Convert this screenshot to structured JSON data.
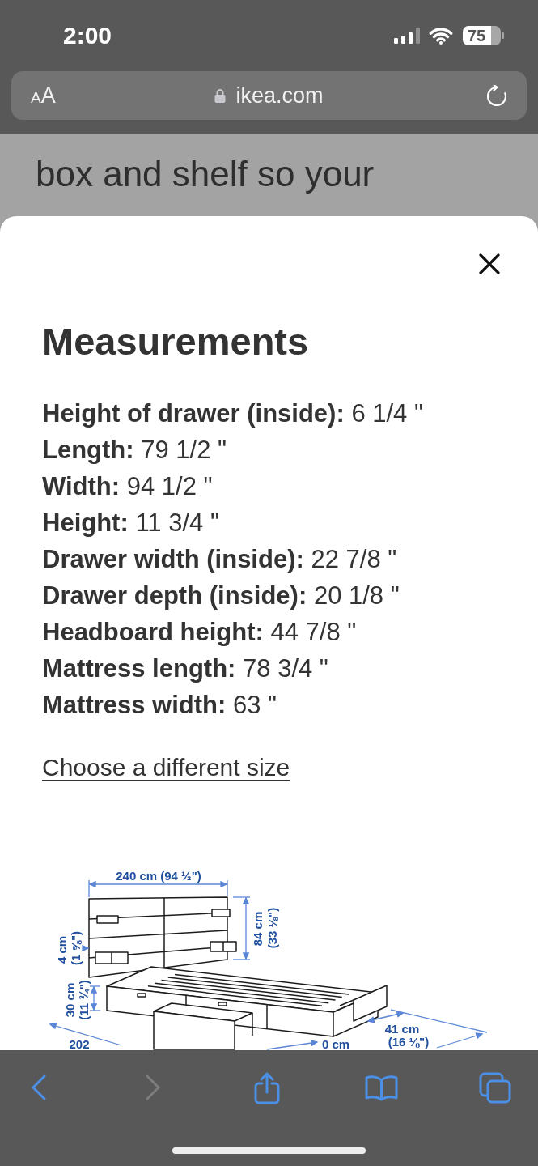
{
  "status_bar": {
    "time": "2:00",
    "battery": "75"
  },
  "address_bar": {
    "text_size_button": "AA",
    "domain": "ikea.com"
  },
  "background_page": {
    "text": "box and shelf so your"
  },
  "sheet": {
    "title": "Measurements",
    "measurements": [
      {
        "label": "Height of drawer (inside):",
        "value": "6 1/4 \""
      },
      {
        "label": "Length:",
        "value": "79 1/2 \""
      },
      {
        "label": "Width:",
        "value": "94 1/2 \""
      },
      {
        "label": "Height:",
        "value": "11 3/4 \""
      },
      {
        "label": "Drawer width (inside):",
        "value": "22 7/8 \""
      },
      {
        "label": "Drawer depth (inside):",
        "value": "20 1/8 \""
      },
      {
        "label": "Headboard height:",
        "value": "44 7/8 \""
      },
      {
        "label": "Mattress length:",
        "value": "78 3/4 \""
      },
      {
        "label": "Mattress width:",
        "value": "63 \""
      }
    ],
    "link": "Choose a different size",
    "diagram": {
      "labels": [
        "240 cm (94 ½\")",
        "84 cm",
        "(33 ⅛\")",
        "4 cm",
        "(1 ⅝\")",
        "30 cm",
        "(11 ¾\")",
        "202",
        "0 cm",
        "41 cm",
        "(16 ⅛\")"
      ]
    }
  },
  "toolbar": {
    "buttons": [
      {
        "kind": "back",
        "disabled": false
      },
      {
        "kind": "forward",
        "disabled": true
      },
      {
        "kind": "share",
        "disabled": false
      },
      {
        "kind": "bookmarks",
        "disabled": false
      },
      {
        "kind": "tabs",
        "disabled": false
      }
    ]
  }
}
